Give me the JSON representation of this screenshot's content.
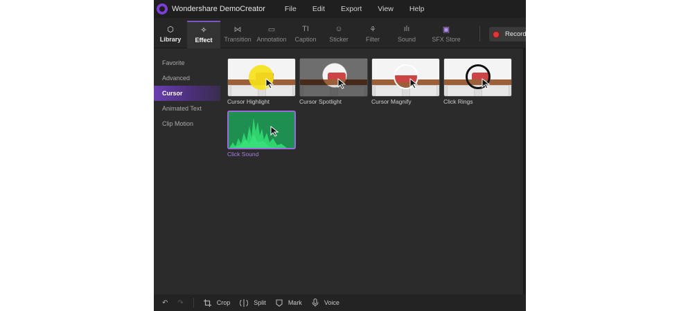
{
  "app": {
    "title": "Wondershare DemoCreator"
  },
  "menu": [
    "File",
    "Edit",
    "Export",
    "View",
    "Help"
  ],
  "toolbar": {
    "items": [
      {
        "label": "Library",
        "icon": "cube-icon",
        "glyph": "⬡"
      },
      {
        "label": "Effect",
        "icon": "magic-wand-icon",
        "glyph": "✧"
      },
      {
        "label": "Transition",
        "icon": "transition-icon",
        "glyph": "⋈"
      },
      {
        "label": "Annotation",
        "icon": "annotation-icon",
        "glyph": "▭"
      },
      {
        "label": "Caption",
        "icon": "caption-icon",
        "glyph": "TI"
      },
      {
        "label": "Sticker",
        "icon": "sticker-icon",
        "glyph": "☺"
      },
      {
        "label": "Filter",
        "icon": "filter-icon",
        "glyph": "⚘"
      },
      {
        "label": "Sound",
        "icon": "sound-icon",
        "glyph": "ılı"
      },
      {
        "label": "SFX Store",
        "icon": "store-icon",
        "glyph": "▣"
      }
    ],
    "record_label": "Record"
  },
  "sidebar": {
    "items": [
      {
        "label": "Favorite"
      },
      {
        "label": "Advanced"
      },
      {
        "label": "Cursor"
      },
      {
        "label": "Animated Text"
      },
      {
        "label": "Clip Motion"
      }
    ],
    "active": "Cursor"
  },
  "effects": [
    {
      "name": "Cursor Highlight"
    },
    {
      "name": "Cursor Spotlight"
    },
    {
      "name": "Cursor Magnify"
    },
    {
      "name": "Click Rings"
    },
    {
      "name": "Click Sound"
    }
  ],
  "bottombar": {
    "undo_glyph": "↶",
    "redo_glyph": "↷",
    "crop": "Crop",
    "split": "Split",
    "mark": "Mark",
    "voice": "Voice"
  },
  "colors": {
    "accent": "#7d54c4",
    "selected_border": "#9a6bdd",
    "record": "#e53535",
    "highlight_yellow": "#f5e11a",
    "click_sound_green": "#1e8a4e"
  }
}
